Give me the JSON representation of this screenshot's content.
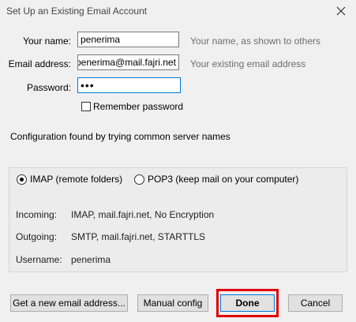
{
  "window": {
    "title": "Set Up an Existing Email Account"
  },
  "form": {
    "name_label": "Your name:",
    "name_value": "penerima",
    "name_hint": "Your name, as shown to others",
    "email_label": "Email address:",
    "email_value": "penerima@mail.fajri.net",
    "email_hint": "Your existing email address",
    "password_label": "Password:",
    "password_value": "•••",
    "remember_label": "Remember password",
    "remember_checked": false
  },
  "status": {
    "message": "Configuration found by trying common server names"
  },
  "protocol": {
    "imap_label": "IMAP (remote folders)",
    "pop3_label": "POP3 (keep mail on your computer)",
    "selected": "IMAP"
  },
  "server_info": [
    {
      "key": "Incoming:",
      "value": "IMAP, mail.fajri.net, No Encryption"
    },
    {
      "key": "Outgoing:",
      "value": "SMTP, mail.fajri.net, STARTTLS"
    },
    {
      "key": "Username:",
      "value": "penerima"
    }
  ],
  "buttons": {
    "new_account": "Get a new email address...",
    "manual_config": "Manual config",
    "done": "Done",
    "cancel": "Cancel"
  },
  "colors": {
    "highlight": "#e10000",
    "focus": "#0078d7",
    "hint_text": "#6d6d6d"
  }
}
